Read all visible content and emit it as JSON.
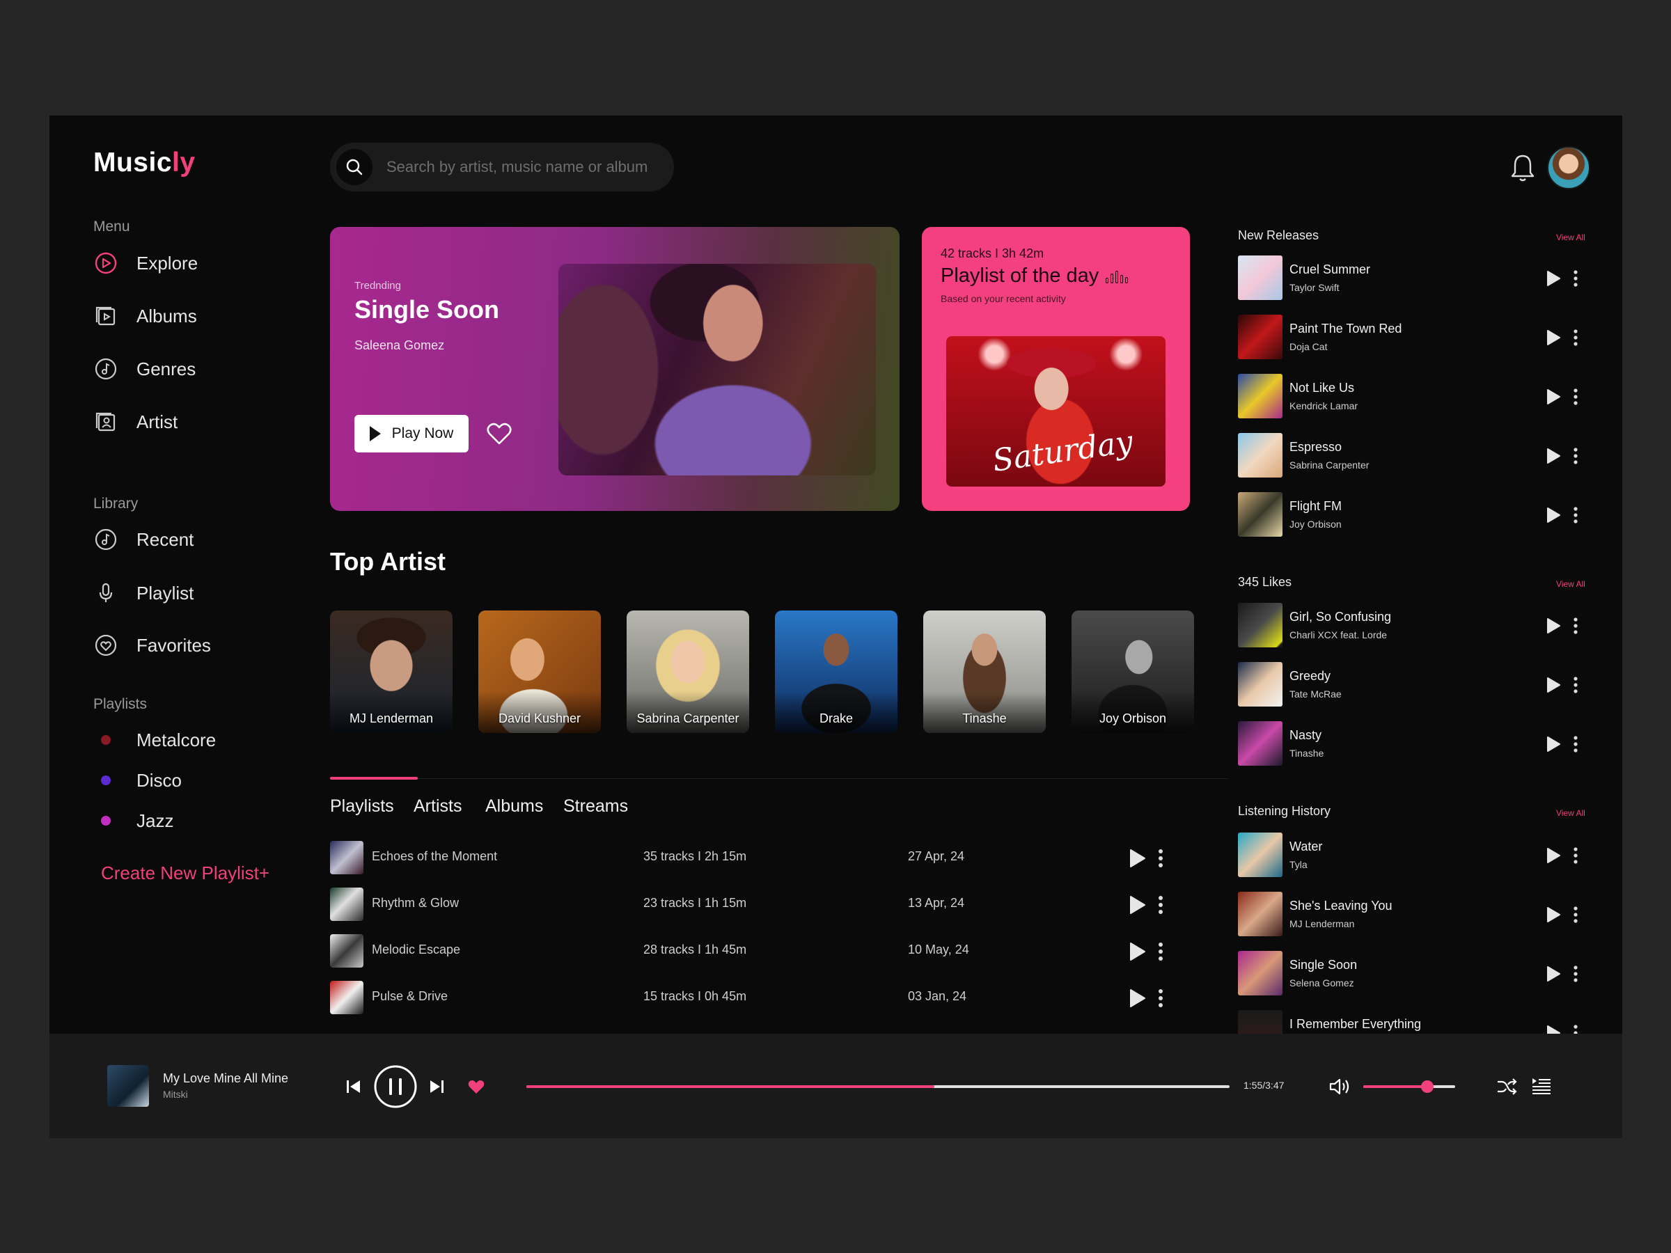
{
  "app": {
    "logo_main": "Music",
    "logo_accent": "ly"
  },
  "colors": {
    "accent": "#f0407d",
    "background": "#0a0a0a",
    "player": "#1a1a1a"
  },
  "sidebar": {
    "menu_label": "Menu",
    "menu": [
      {
        "label": "Explore",
        "icon": "play-circle-icon"
      },
      {
        "label": "Albums",
        "icon": "album-icon"
      },
      {
        "label": "Genres",
        "icon": "music-note-icon"
      },
      {
        "label": "Artist",
        "icon": "artist-icon"
      }
    ],
    "library_label": "Library",
    "library": [
      {
        "label": "Recent",
        "icon": "music-note-icon"
      },
      {
        "label": "Playlist",
        "icon": "microphone-icon"
      },
      {
        "label": "Favorites",
        "icon": "heart-icon"
      }
    ],
    "playlists_label": "Playlists",
    "playlists": [
      {
        "label": "Metalcore",
        "color": "#8a1a24"
      },
      {
        "label": "Disco",
        "color": "#5b2bd1"
      },
      {
        "label": "Jazz",
        "color": "#c22fbf"
      }
    ],
    "create_label": "Create New Playlist+"
  },
  "search": {
    "placeholder": "Search by artist, music name or album"
  },
  "hero": {
    "tag": "Trednding",
    "title": "Single Soon",
    "artist": "Saleena Gomez",
    "play_label": "Play Now"
  },
  "potd": {
    "meta": "42 tracks I 3h 42m",
    "title": "Playlist of the day",
    "subtitle": "Based on your recent activity",
    "cover_text": "Saturday"
  },
  "top_artist": {
    "title": "Top Artist",
    "artists": [
      "MJ Lenderman",
      "David Kushner",
      "Sabrina Carpenter",
      "Drake",
      "Tinashe",
      "Joy Orbison"
    ]
  },
  "tabs": [
    "Playlists",
    "Artists",
    "Albums",
    "Streams"
  ],
  "playlists_table": [
    {
      "title": "Echoes of the Moment",
      "tracks": "35 tracks I 2h 15m",
      "date": "27 Apr, 24"
    },
    {
      "title": "Rhythm & Glow",
      "tracks": "23 tracks I 1h 15m",
      "date": "13 Apr, 24"
    },
    {
      "title": "Melodic Escape",
      "tracks": "28 tracks I 1h 45m",
      "date": "10 May, 24"
    },
    {
      "title": "Pulse & Drive",
      "tracks": "15 tracks I 0h 45m",
      "date": "03 Jan, 24"
    }
  ],
  "right_panel": {
    "new_releases": {
      "title": "New Releases",
      "view_all": "View All",
      "items": [
        {
          "title": "Cruel Summer",
          "artist": "Taylor Swift"
        },
        {
          "title": "Paint The Town Red",
          "artist": "Doja Cat"
        },
        {
          "title": "Not Like Us",
          "artist": "Kendrick Lamar"
        },
        {
          "title": "Espresso",
          "artist": "Sabrina Carpenter"
        },
        {
          "title": "Flight FM",
          "artist": "Joy Orbison"
        }
      ]
    },
    "likes": {
      "title": "345 Likes",
      "view_all": "View All",
      "items": [
        {
          "title": "Girl, So Confusing",
          "artist": "Charli XCX feat. Lorde"
        },
        {
          "title": "Greedy",
          "artist": "Tate McRae"
        },
        {
          "title": "Nasty",
          "artist": "Tinashe"
        }
      ]
    },
    "history": {
      "title": "Listening History",
      "view_all": "View All",
      "items": [
        {
          "title": "Water",
          "artist": "Tyla"
        },
        {
          "title": "She's Leaving You",
          "artist": "MJ Lenderman"
        },
        {
          "title": "Single Soon",
          "artist": "Selena Gomez"
        },
        {
          "title": "I Remember Everything",
          "artist": ""
        }
      ]
    }
  },
  "player": {
    "title": "My Love Mine All Mine",
    "artist": "Mitski",
    "time": "1:55/3:47",
    "progress": 0.58,
    "volume": 0.7
  }
}
